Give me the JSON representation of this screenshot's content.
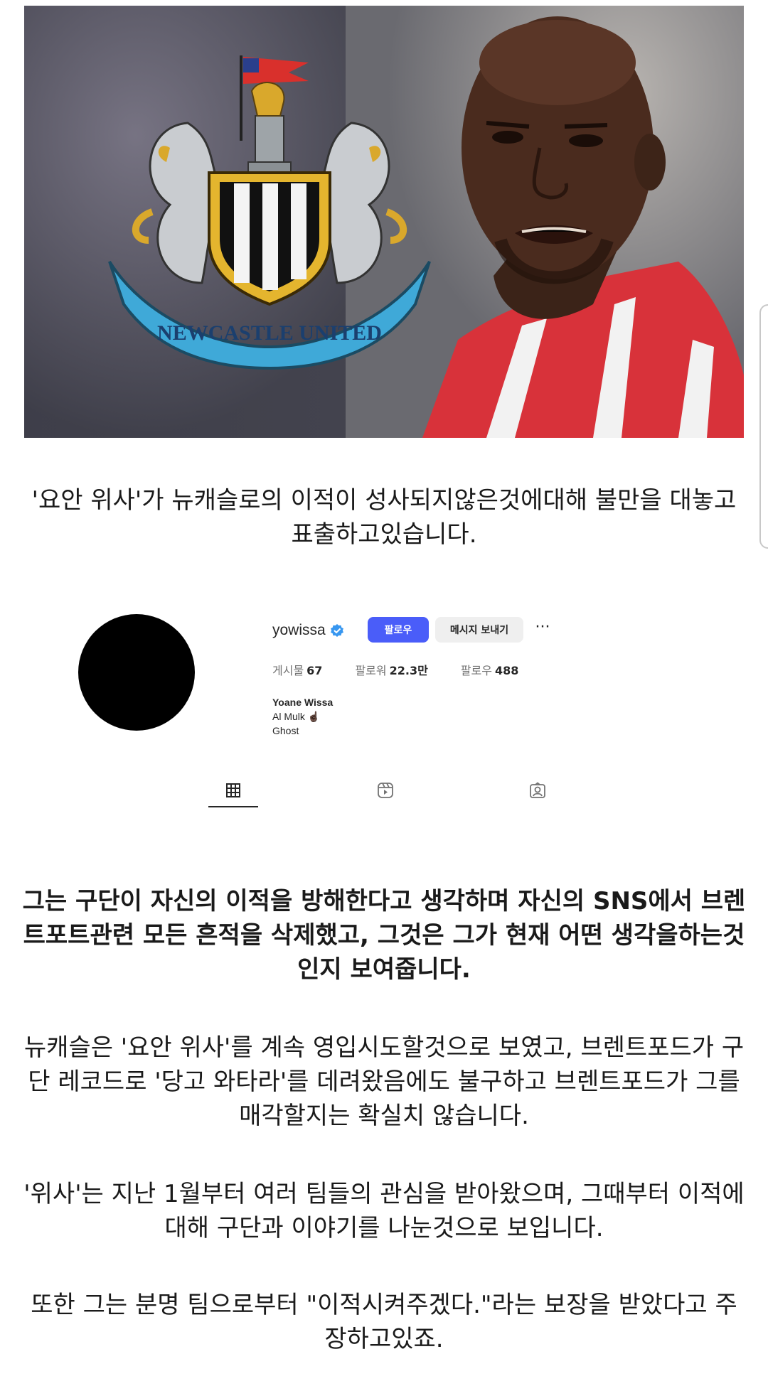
{
  "hero": {
    "crest_text": "NEWCASTLE UNITED"
  },
  "caption": "'요안 위사'가 뉴캐슬로의 이적이 성사되지않은것에대해 불만을 대놓고 표출하고있습니다.",
  "profile": {
    "username": "yowissa",
    "follow_label": "팔로우",
    "message_label": "메시지 보내기",
    "more_label": "···",
    "stats": [
      {
        "label": "게시물",
        "value": "67"
      },
      {
        "label": "팔로워",
        "value": "22.3만"
      },
      {
        "label": "팔로우",
        "value": "488"
      }
    ],
    "bio_name": "Yoane Wissa",
    "bio_line1": "Al Mulk ☝🏿",
    "bio_line2": "Ghost",
    "accent_color": "#4a5df9"
  },
  "paragraphs": [
    "그는 구단이 자신의 이적을 방해한다고 생각하며 자신의 SNS에서 브렌트포트관련 모든 흔적을 삭제했고, 그것은 그가 현재 어떤 생각을하는것인지 보여줍니다.",
    "뉴캐슬은 '요안 위사'를 계속 영입시도할것으로 보였고, 브렌트포드가 구단 레코드로 '당고 와타라'를 데려왔음에도 불구하고 브렌트포드가 그를 매각할지는 확실치 않습니다.",
    "'위사'는 지난 1월부터 여러 팀들의 관심을 받아왔으며, 그때부터 이적에 대해 구단과 이야기를 나눈것으로 보입니다.",
    "또한 그는 분명 팀으로부터 \"이적시켜주겠다.\"라는 보장을 받았다고 주장하고있죠."
  ]
}
